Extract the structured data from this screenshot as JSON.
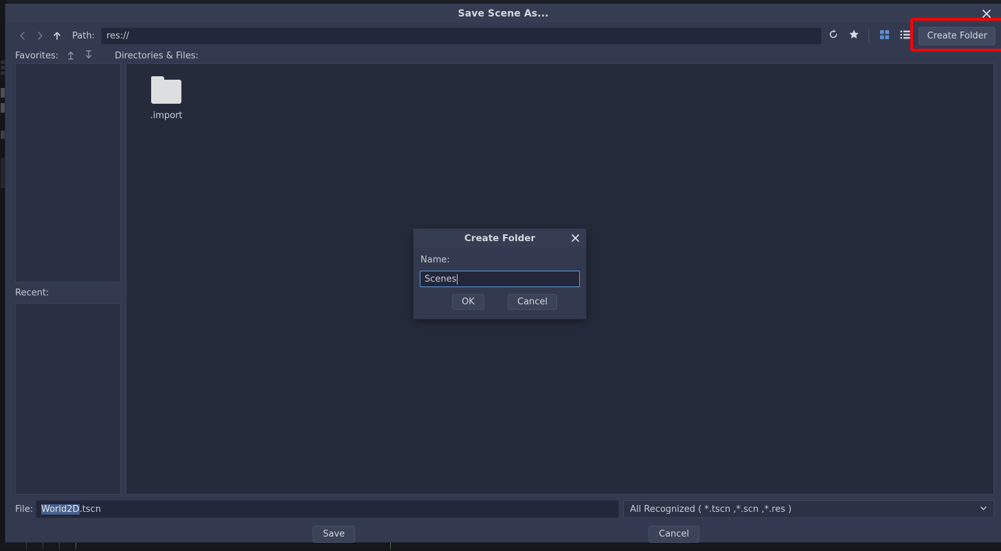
{
  "window": {
    "title": "Save Scene As...",
    "close_icon": "close-icon"
  },
  "toolbar": {
    "back_icon": "chevron-left-icon",
    "forward_icon": "chevron-right-icon",
    "up_icon": "arrow-up-icon",
    "path_label": "Path:",
    "path_value": "res://",
    "refresh_icon": "refresh-icon",
    "favorite_icon": "star-icon",
    "grid_view_icon": "grid-view-icon",
    "list_view_icon": "list-view-icon",
    "create_folder_label": "Create Folder",
    "highlight_color": "#fe0000"
  },
  "sidebar": {
    "favorites_label": "Favorites:",
    "move_up_icon": "arrow-up-bar-icon",
    "move_down_icon": "arrow-down-bar-icon",
    "favorites_items": [],
    "recent_label": "Recent:",
    "recent_items": []
  },
  "files": {
    "header_label": "Directories & Files:",
    "items": [
      {
        "name": ".import",
        "type": "folder",
        "icon": "folder-icon"
      }
    ]
  },
  "file_row": {
    "label": "File:",
    "value_selected": "World2D",
    "value_rest": ".tscn",
    "filter_value": "All Recognized ( *.tscn ,*.scn ,*.res  )",
    "filter_chevron_icon": "chevron-down-icon",
    "filter_options": [
      "All Recognized ( *.tscn ,*.scn ,*.res  )"
    ]
  },
  "actions": {
    "save_label": "Save",
    "cancel_label": "Cancel"
  },
  "create_folder_dialog": {
    "title": "Create Folder",
    "close_icon": "close-icon",
    "name_label": "Name:",
    "name_value": "Scenes",
    "ok_label": "OK",
    "cancel_label": "Cancel",
    "focus_border_color": "#5b9fe0"
  }
}
